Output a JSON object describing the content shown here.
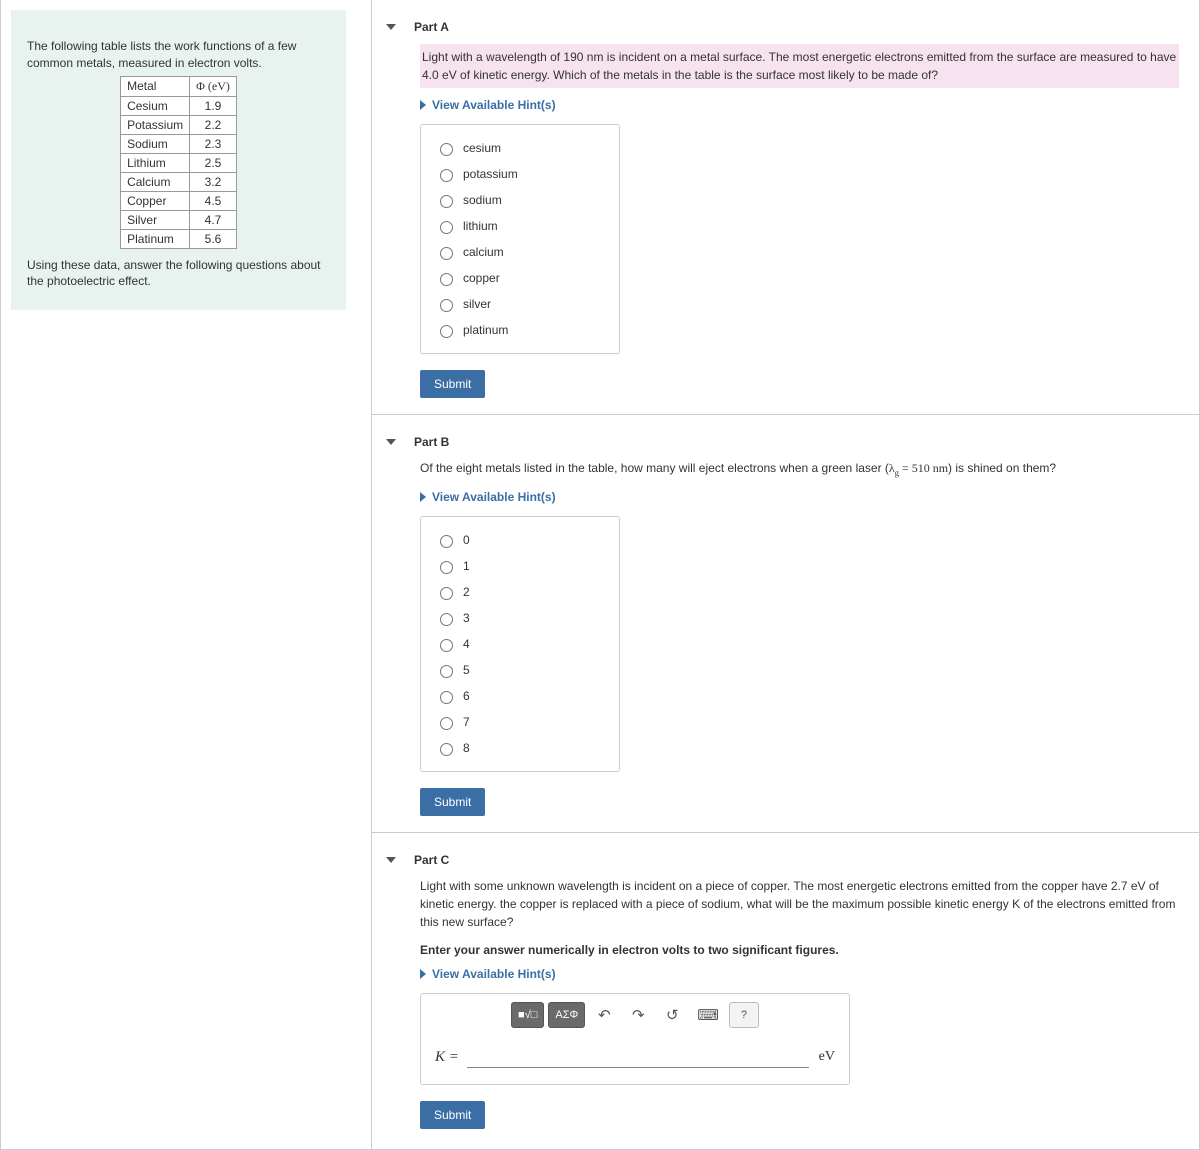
{
  "intro": {
    "text1": "The following table lists the work functions of a few common metals, measured in electron volts.",
    "text2": "Using these data, answer the following questions about the photoelectric effect.",
    "table": {
      "h1": "Metal",
      "h2": "Φ (eV)",
      "rows": [
        {
          "m": "Cesium",
          "v": "1.9"
        },
        {
          "m": "Potassium",
          "v": "2.2"
        },
        {
          "m": "Sodium",
          "v": "2.3"
        },
        {
          "m": "Lithium",
          "v": "2.5"
        },
        {
          "m": "Calcium",
          "v": "3.2"
        },
        {
          "m": "Copper",
          "v": "4.5"
        },
        {
          "m": "Silver",
          "v": "4.7"
        },
        {
          "m": "Platinum",
          "v": "5.6"
        }
      ]
    }
  },
  "hints_label": "View Available Hint(s)",
  "submit_label": "Submit",
  "partA": {
    "title": "Part A",
    "prompt": "Light with a wavelength of 190 nm is incident on a metal surface. The most energetic electrons emitted from the surface are measured to have 4.0 eV of kinetic energy. Which of the metals in the table is the surface most likely to be made of?",
    "options": [
      "cesium",
      "potassium",
      "sodium",
      "lithium",
      "calcium",
      "copper",
      "silver",
      "platinum"
    ]
  },
  "partB": {
    "title": "Part B",
    "prompt_pre": "Of the eight metals listed in the table, how many will eject electrons when a green laser (",
    "prompt_lambda": "λg = 510 nm",
    "prompt_post": ") is shined on them?",
    "options": [
      "0",
      "1",
      "2",
      "3",
      "4",
      "5",
      "6",
      "7",
      "8"
    ]
  },
  "partC": {
    "title": "Part C",
    "prompt": "Light with some unknown wavelength is incident on a piece of copper. The most energetic electrons emitted from the copper have 2.7 eV of kinetic energy. the copper is replaced with a piece of sodium, what will be the maximum possible kinetic energy K of the electrons emitted from this new surface?",
    "instr": "Enter your answer numerically in electron volts to two significant figures.",
    "lhs": "K",
    "unit": "eV",
    "toolbar": {
      "tpl": "x□",
      "frac": "√□",
      "greek": "ΑΣΦ",
      "undo": "↶",
      "redo": "↷",
      "reset": "↺",
      "kbd": "⌨",
      "help": "?"
    }
  }
}
